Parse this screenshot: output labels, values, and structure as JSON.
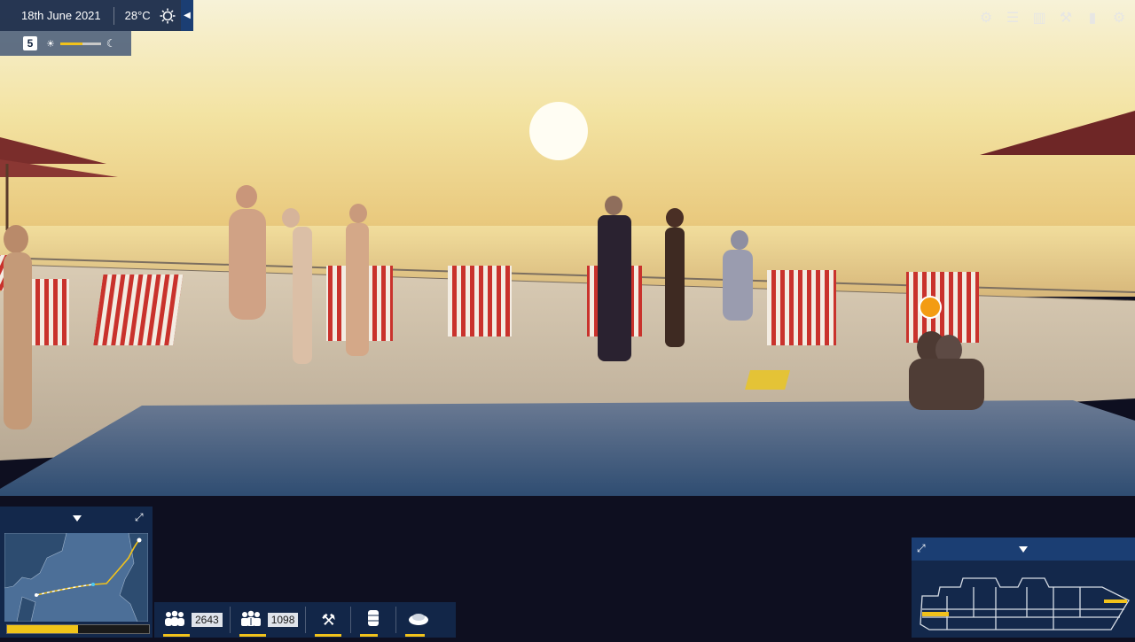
{
  "topbar": {
    "date": "18th June 2021",
    "temperature": "28°C"
  },
  "timebar": {
    "day": "5",
    "progress": 0.55
  },
  "top_icons": [
    "settings-cog-icon",
    "server-icon",
    "bar-chart-icon",
    "broom-icon",
    "book-icon",
    "gear-icon"
  ],
  "stats": {
    "passengers_value": "2643",
    "crew_value": "1098"
  },
  "map": {
    "journey_progress": 0.5
  },
  "colors": {
    "accent": "#f1c21b",
    "panel": "#13284b",
    "panel_header": "#1b3e73"
  }
}
